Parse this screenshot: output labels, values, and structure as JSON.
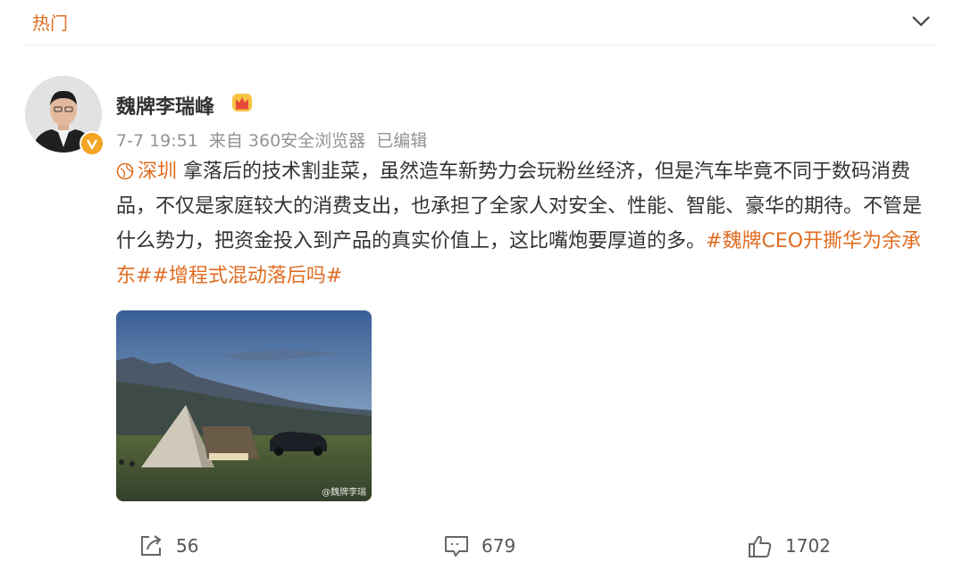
{
  "header": {
    "title": "热门"
  },
  "post": {
    "author": "魏牌李瑞峰",
    "meta": {
      "time": "7-7 19:51",
      "source": "来自 360安全浏览器",
      "edited": "已编辑"
    },
    "location": "深圳",
    "text": "拿落后的技术割韭菜，虽然造车新势力会玩粉丝经济，但是汽车毕竟不同于数码消费品，不仅是家庭较大的消费支出，也承担了全家人对安全、性能、智能、豪华的期待。不管是什么势力，把资金投入到产品的真实价值上，这比嘴炮要厚道的多。",
    "hashtags": "#魏牌CEO开撕华为余承东##增程式混动落后吗#",
    "image_watermark": "@魏牌李瑞"
  },
  "actions": {
    "repost_count": "56",
    "comment_count": "679",
    "like_count": "1702"
  },
  "colors": {
    "accent": "#e06d23",
    "meta": "#939393",
    "verified": "#f5a524"
  },
  "icons": [
    "chevron-down-icon",
    "verified-icon",
    "crown-icon",
    "location-icon",
    "repost-icon",
    "comment-icon",
    "like-icon"
  ]
}
